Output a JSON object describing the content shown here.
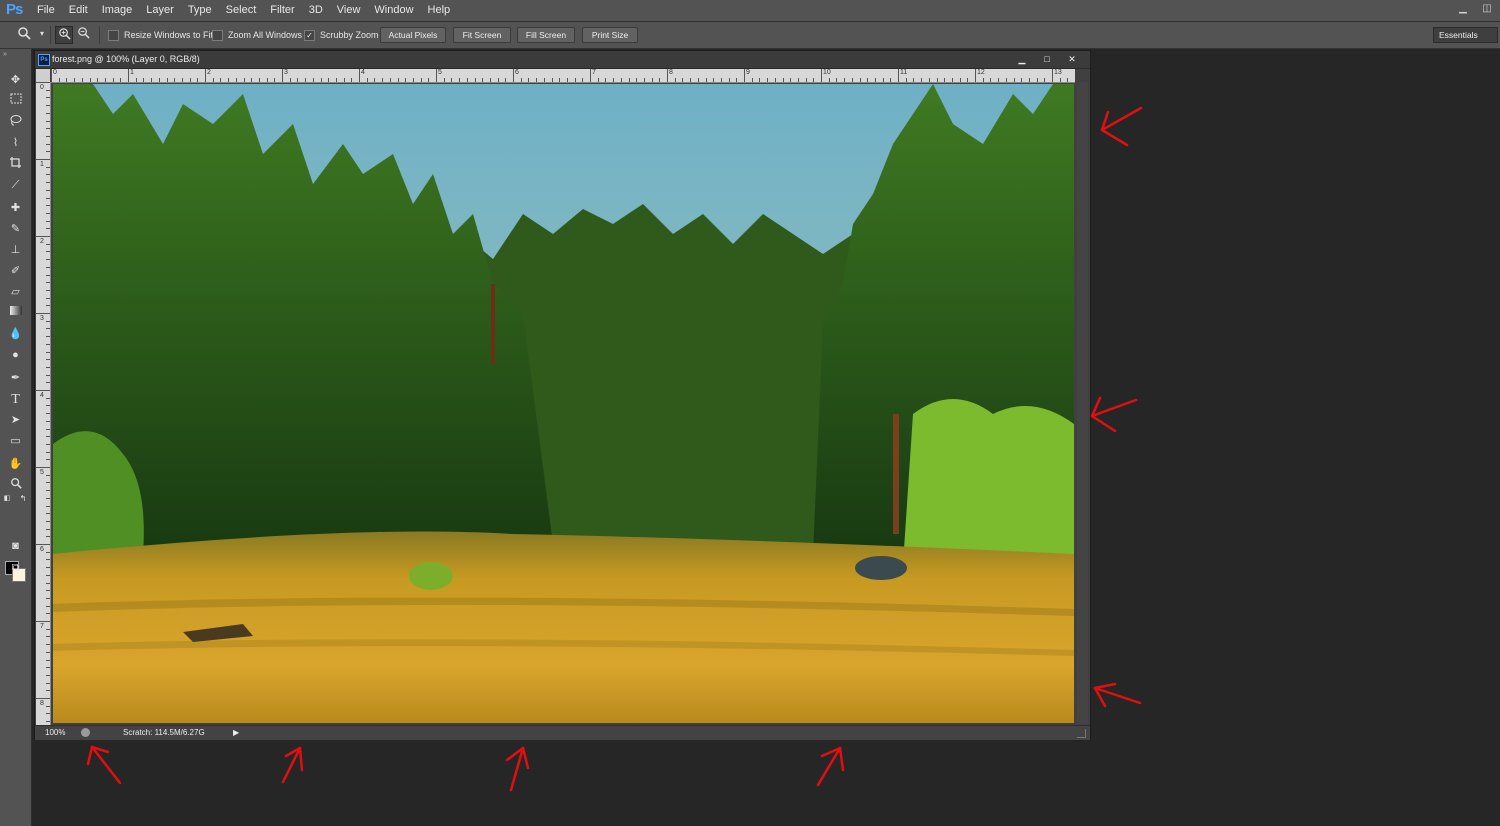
{
  "app": {
    "logo": "Ps"
  },
  "menu": [
    "File",
    "Edit",
    "Image",
    "Layer",
    "Type",
    "Select",
    "Filter",
    "3D",
    "View",
    "Window",
    "Help"
  ],
  "window_controls": {
    "minimize": "▁",
    "restore": "◫"
  },
  "options": {
    "resize_windows_label": "Resize Windows to Fit",
    "resize_windows_checked": false,
    "zoom_all_label": "Zoom All Windows",
    "zoom_all_checked": false,
    "scrubby_label": "Scrubby Zoom",
    "scrubby_checked": true,
    "btn_actual": "Actual Pixels",
    "btn_fit": "Fit Screen",
    "btn_fill": "Fill Screen",
    "btn_print": "Print Size",
    "workspace": "Essentials"
  },
  "document": {
    "title": "forest.png @ 100% (Layer 0, RGB/8)",
    "ctrl_min": "▁",
    "ctrl_max": "□",
    "ctrl_close": "✕",
    "zoom": "100%",
    "scratch": "Scratch: 114.5M/6.27G",
    "ruler_h": [
      "0",
      "1",
      "2",
      "3",
      "4",
      "5",
      "6",
      "7",
      "8",
      "9",
      "10",
      "11",
      "12",
      "13"
    ],
    "ruler_v": [
      "0",
      "1",
      "2",
      "3",
      "4",
      "5",
      "6",
      "7",
      "8"
    ]
  },
  "colors": {
    "annotation_arrow": "#e01010",
    "foreground": "#000000",
    "background": "#fff4e0",
    "sky": "#7fb7c9",
    "forest": "#2f5a1c",
    "meadow": "#c89a22"
  },
  "tools": [
    "move-icon",
    "marquee-icon",
    "lasso-icon",
    "quick-select-icon",
    "crop-icon",
    "eyedropper-icon",
    "healing-brush-icon",
    "brush-icon",
    "clone-stamp-icon",
    "history-brush-icon",
    "eraser-icon",
    "gradient-icon",
    "blur-icon",
    "dodge-icon",
    "pen-icon",
    "type-icon",
    "path-select-icon",
    "shape-icon",
    "hand-icon",
    "zoom-icon",
    "quick-mask-icon",
    "screen-mode-icon"
  ]
}
